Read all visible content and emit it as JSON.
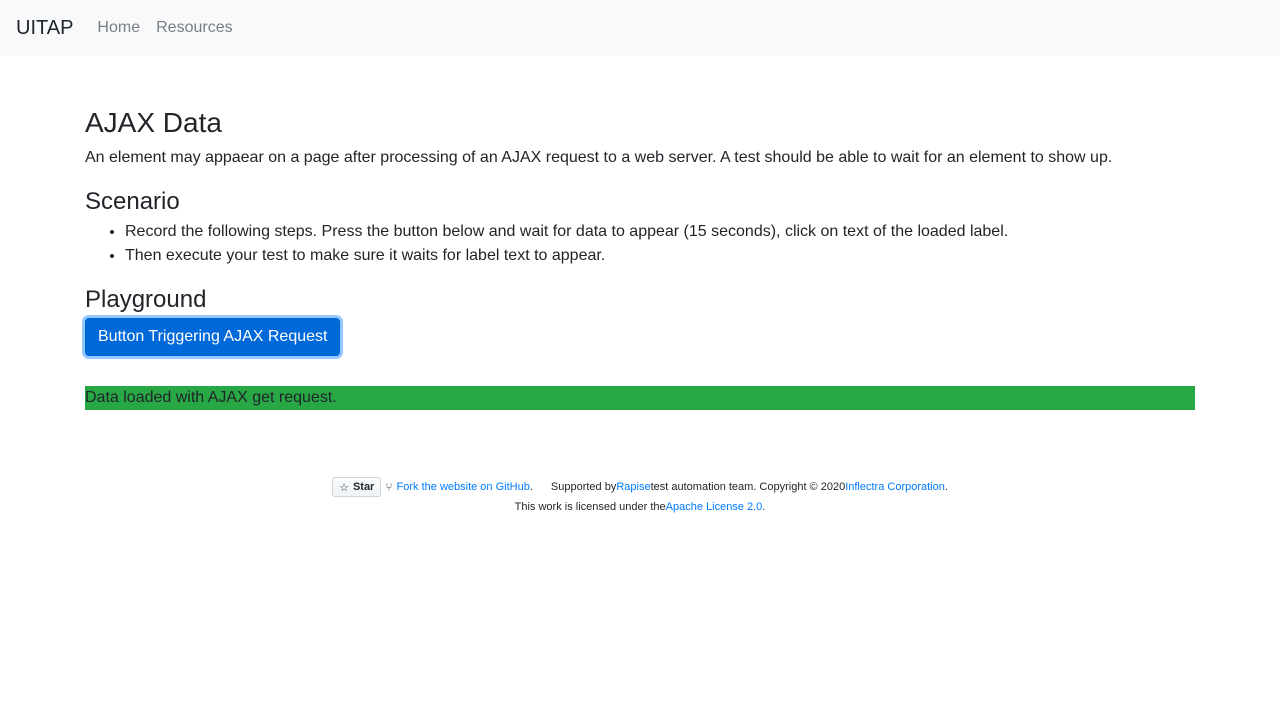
{
  "navbar": {
    "brand": "UITAP",
    "links": [
      "Home",
      "Resources"
    ]
  },
  "main": {
    "title": "AJAX Data",
    "description": "An element may appaear on a page after processing of an AJAX request to a web server. A test should be able to wait for an element to show up.",
    "scenario_heading": "Scenario",
    "steps": [
      "Record the following steps. Press the button below and wait for data to appear (15 seconds), click on text of the loaded label.",
      "Then execute your test to make sure it waits for label text to appear."
    ],
    "playground_heading": "Playground",
    "button_label": "Button Triggering AJAX Request",
    "loaded_label": "Data loaded with AJAX get request."
  },
  "footer": {
    "star_label": "Star",
    "fork_link": "Fork the website on GitHub",
    "fork_suffix": ".",
    "supported_prefix": "Supported by ",
    "rapise_link": "Rapise",
    "supported_middle": " test automation team. Copyright © 2020 ",
    "inflectra_link": "Inflectra Corporation",
    "supported_suffix": ".",
    "license_prefix": "This work is licensed under the ",
    "license_link": "Apache License 2.0",
    "license_suffix": "."
  },
  "colors": {
    "navbar_bg": "#f8f9fa",
    "button_primary": "#0069d9",
    "success": "#28a745",
    "link": "#007bff"
  }
}
